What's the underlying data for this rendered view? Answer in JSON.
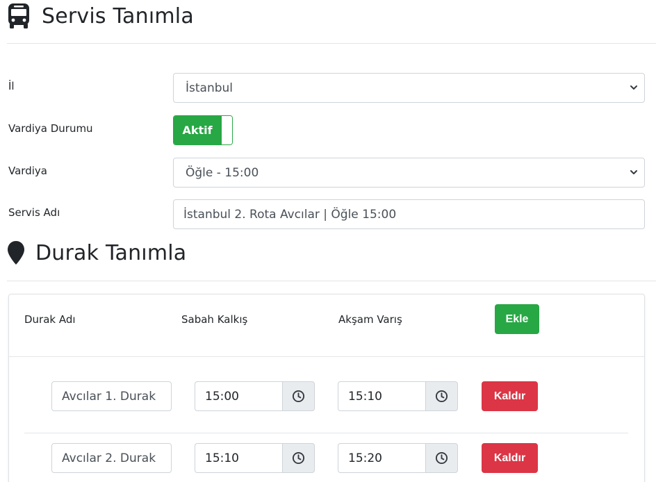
{
  "header": {
    "title": "Servis Tanımla",
    "icon": "bus-icon"
  },
  "form": {
    "il_label": "İl",
    "il_value": "İstanbul",
    "vardiya_durumu_label": "Vardiya Durumu",
    "toggle_label": "Aktif",
    "vardiya_label": "Vardiya",
    "vardiya_value": "Öğle - 15:00",
    "servis_adi_label": "Servis Adı",
    "servis_adi_value": "İstanbul 2. Rota Avcılar | Öğle 15:00"
  },
  "durak_section": {
    "title": "Durak Tanımla",
    "icon": "map-marker-icon"
  },
  "table": {
    "col_durak": "Durak Adı",
    "col_sabah": "Sabah Kalkış",
    "col_aksam": "Akşam Varış",
    "add_label": "Ekle",
    "remove_label": "Kaldır",
    "rows": [
      {
        "durak": "Avcılar 1. Durak",
        "sabah": "15:00",
        "aksam": "15:10"
      },
      {
        "durak": "Avcılar 2. Durak",
        "sabah": "15:10",
        "aksam": "15:20"
      }
    ]
  },
  "colors": {
    "success": "#28a745",
    "danger": "#dc3545",
    "addon": "#e9ecef"
  }
}
